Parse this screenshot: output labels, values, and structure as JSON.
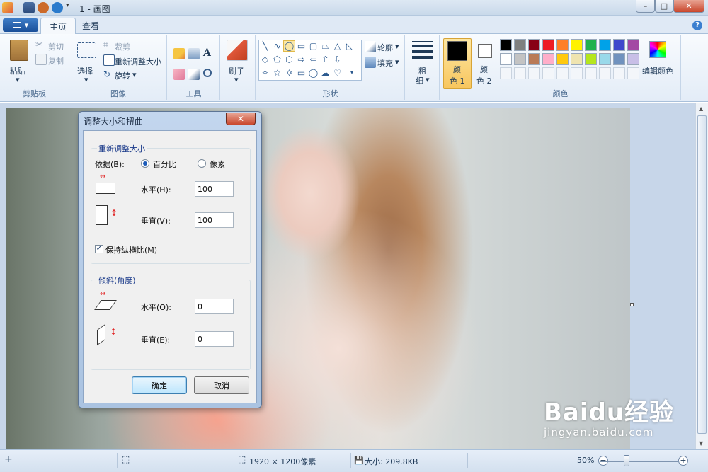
{
  "window": {
    "title": "1 - 画图",
    "controls": {
      "minimize": "–",
      "maximize": "□",
      "close": "✕"
    }
  },
  "menu": {
    "app_button": "▾"
  },
  "tabs": [
    {
      "label": "主页",
      "active": true
    },
    {
      "label": "查看",
      "active": false
    }
  ],
  "ribbon": {
    "clipboard": {
      "label": "剪贴板",
      "paste": "粘贴",
      "cut": "剪切",
      "copy": "复制"
    },
    "image": {
      "label": "图像",
      "select": "选择",
      "crop": "裁剪",
      "resize": "重新调整大小",
      "rotate": "旋转"
    },
    "tools": {
      "label": "工具"
    },
    "brushes": {
      "label": "刷子"
    },
    "shapes": {
      "label": "形状",
      "outline": "轮廓",
      "fill": "填充"
    },
    "size": {
      "line1": "粗",
      "line2": "细"
    },
    "colors": {
      "label": "颜色",
      "color1_a": "颜",
      "color1_b": "色 1",
      "color2_a": "颜",
      "color2_b": "色 2",
      "edit": "编辑颜色",
      "palette_row1": [
        "#000000",
        "#7f7f7f",
        "#880015",
        "#ed1c24",
        "#ff7f27",
        "#fff200",
        "#22b14c",
        "#00a2e8",
        "#3f48cc",
        "#a349a4"
      ],
      "palette_row2": [
        "#ffffff",
        "#c3c3c3",
        "#b97a57",
        "#ffaec9",
        "#ffc90e",
        "#efe4b0",
        "#b5e61d",
        "#99d9ea",
        "#7092be",
        "#c8bfe7"
      ]
    }
  },
  "dialog": {
    "title": "调整大小和扭曲",
    "close": "✕",
    "resize": {
      "legend": "重新调整大小",
      "by_label": "依据(B):",
      "percent": "百分比",
      "pixels": "像素",
      "horizontal_label": "水平(H):",
      "horizontal_value": "100",
      "vertical_label": "垂直(V):",
      "vertical_value": "100",
      "keep_ratio": "保持纵横比(M)"
    },
    "skew": {
      "legend": "倾斜(角度)",
      "horizontal_label": "水平(O):",
      "horizontal_value": "0",
      "vertical_label": "垂直(E):",
      "vertical_value": "0"
    },
    "ok": "确定",
    "cancel": "取消"
  },
  "status": {
    "dimensions": "1920 × 1200像素",
    "size": "大小: 209.8KB",
    "zoom": "50%"
  },
  "watermark": {
    "logo": "Baidu经验",
    "url": "jingyan.baidu.com"
  }
}
